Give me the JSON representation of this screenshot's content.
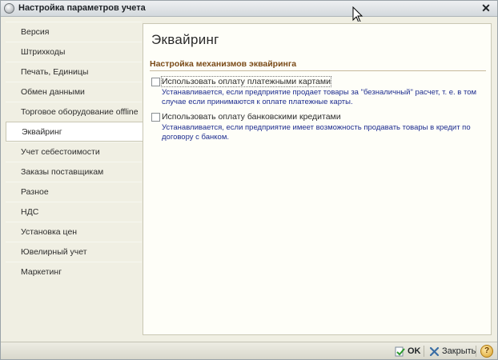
{
  "window": {
    "title": "Настройка параметров учета"
  },
  "sidebar": {
    "items": [
      {
        "label": "Версия"
      },
      {
        "label": "Штрихкоды"
      },
      {
        "label": "Печать, Единицы"
      },
      {
        "label": "Обмен данными"
      },
      {
        "label": "Торговое оборудование offline"
      },
      {
        "label": "Эквайринг",
        "selected": true
      },
      {
        "label": "Учет себестоимости"
      },
      {
        "label": "Заказы поставщикам"
      },
      {
        "label": "Разное"
      },
      {
        "label": "НДС"
      },
      {
        "label": "Установка цен"
      },
      {
        "label": "Ювелирный учет"
      },
      {
        "label": "Маркетинг"
      }
    ]
  },
  "main": {
    "title": "Эквайринг",
    "section_header": "Настройка механизмов эквайринга",
    "options": [
      {
        "label": "Использовать оплату платежными картами",
        "checked": false,
        "description": "Устанавливается, если предприятие продает товары за \"безналичный\" расчет, т. е. в том случае если принимаются к оплате платежные карты."
      },
      {
        "label": "Использовать оплату банковскими кредитами",
        "checked": false,
        "description": "Устанавливается, если предприятие имеет возможность продавать товары в кредит по договору с банком."
      }
    ]
  },
  "footer": {
    "ok_label": "OK",
    "close_label": "Закрыть",
    "help_symbol": "?"
  },
  "colors": {
    "section_header": "#7a4a18",
    "description_text": "#1e2d8f",
    "panel_bg": "#f0efe3"
  }
}
